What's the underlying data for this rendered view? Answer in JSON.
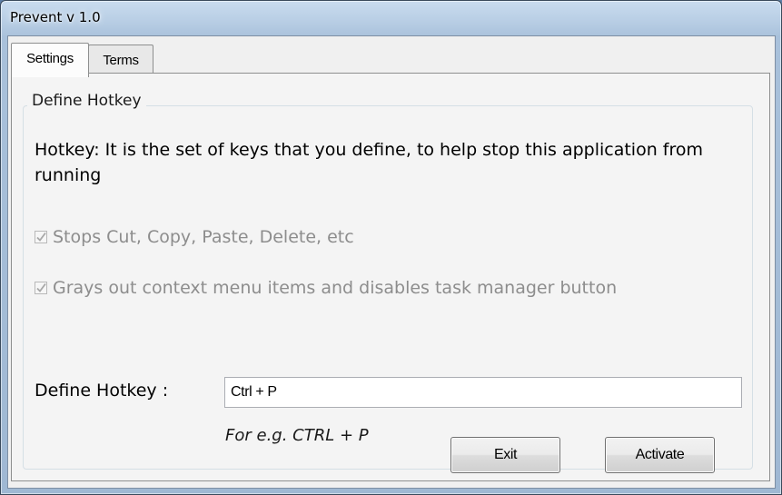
{
  "window": {
    "title": "Prevent v 1.0"
  },
  "tabs": [
    {
      "label": "Settings",
      "active": true
    },
    {
      "label": "Terms",
      "active": false
    }
  ],
  "settings": {
    "group_title": "Define Hotkey",
    "description": "Hotkey: It is the set of keys that you define, to help stop this application from running",
    "options": [
      {
        "label": "Stops Cut, Copy, Paste, Delete, etc",
        "checked": true,
        "enabled": false
      },
      {
        "label": "Grays out context menu items and disables task manager button",
        "checked": true,
        "enabled": false
      }
    ],
    "hotkey_label": "Define Hotkey :",
    "hotkey_value": "Ctrl + P",
    "example": "For e.g. CTRL + P",
    "exit_button": "Exit",
    "activate_button": "Activate"
  },
  "colors": {
    "window_frame": "#a9c1db",
    "client_background": "#f0f0f0",
    "disabled_text": "#8d8d8d"
  }
}
